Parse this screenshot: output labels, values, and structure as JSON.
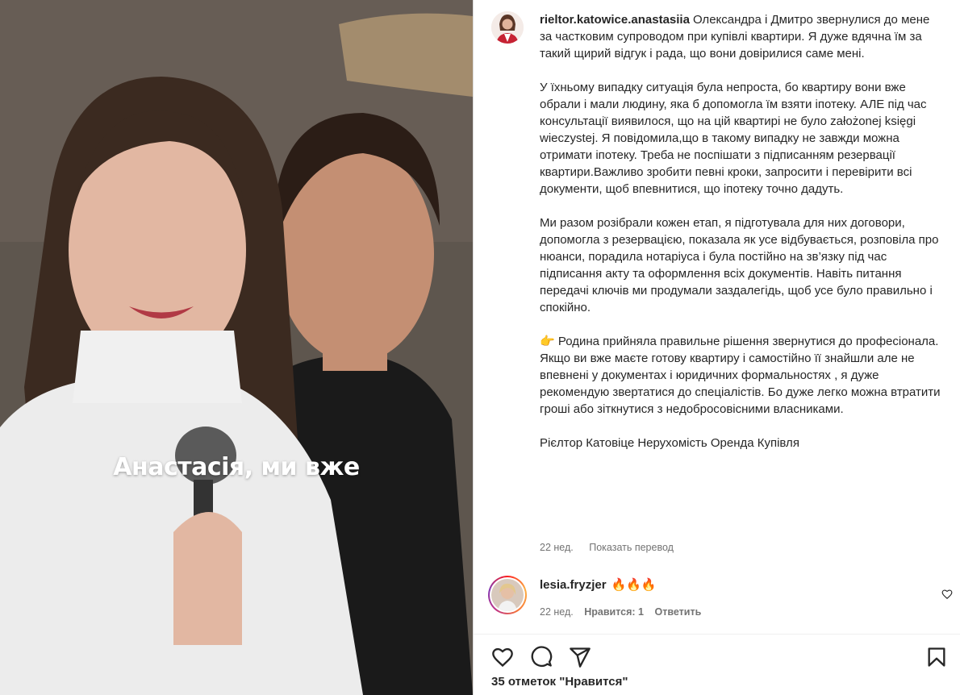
{
  "media": {
    "overlay_caption": "Анастасія, ми вже"
  },
  "post": {
    "author_username": "rieltor.katowice.anastasiia",
    "caption": "Олександра і Дмитро звернулися до мене за частковим супроводом при купівлі квартири. Я дуже вдячна їм за такий щирий відгук і рада, що вони довірилися саме мені.\n\nУ їхньому випадку ситуація була непроста, бо квартиру вони вже обрали і мали людину, яка б допомогла їм взяти іпотеку. АЛЕ під час консультації виявилося, що на цій квартирі не було założonej księgi wieczystej. Я повідомила,що в такому випадку не завжди можна отримати іпотеку. Треба не поспішати з підписанням резервації квартири.Важливо зробити певні кроки, запросити і перевірити всі документи, щоб впевнитися, що іпотеку точно дадуть.\n\nМи разом розібрали кожен етап, я підготувала для них договори, допомогла з резервацією, показала як усе відбувається, розповіла про нюанси, порадила нотаріуса і була постійно на зв’язку під час підписання акту та оформлення всіх документів. Навіть питання передачі ключів ми продумали заздалегідь, щоб усе було правильно і спокійно.\n\n👉 Родина прийняла правильне рішення звернутися до професіонала. Якщо ви вже маєте готову квартиру і самостійно її знайшли але не впевнені у документах і юридичних формальностях , я дуже рекомендую звертатися до спеціалістів. Бо дуже легко можна втратити гроші або зіткнутися з недобросовісними власниками.\n\nРієлтор Катовіце Нерухомість Оренда Купівля",
    "time_ago": "22 нед.",
    "translate_label": "Показать перевод"
  },
  "comment": {
    "username": "lesia.fryzjer",
    "text": "🔥🔥🔥",
    "time_ago": "22 нед.",
    "likes_label": "Нравится: 1",
    "reply_label": "Ответить"
  },
  "actions": {
    "likes_text": "35 отметок \"Нравится\""
  },
  "icons": {
    "like": "heart-icon",
    "comment": "comment-icon",
    "share": "share-icon",
    "save": "bookmark-icon"
  }
}
